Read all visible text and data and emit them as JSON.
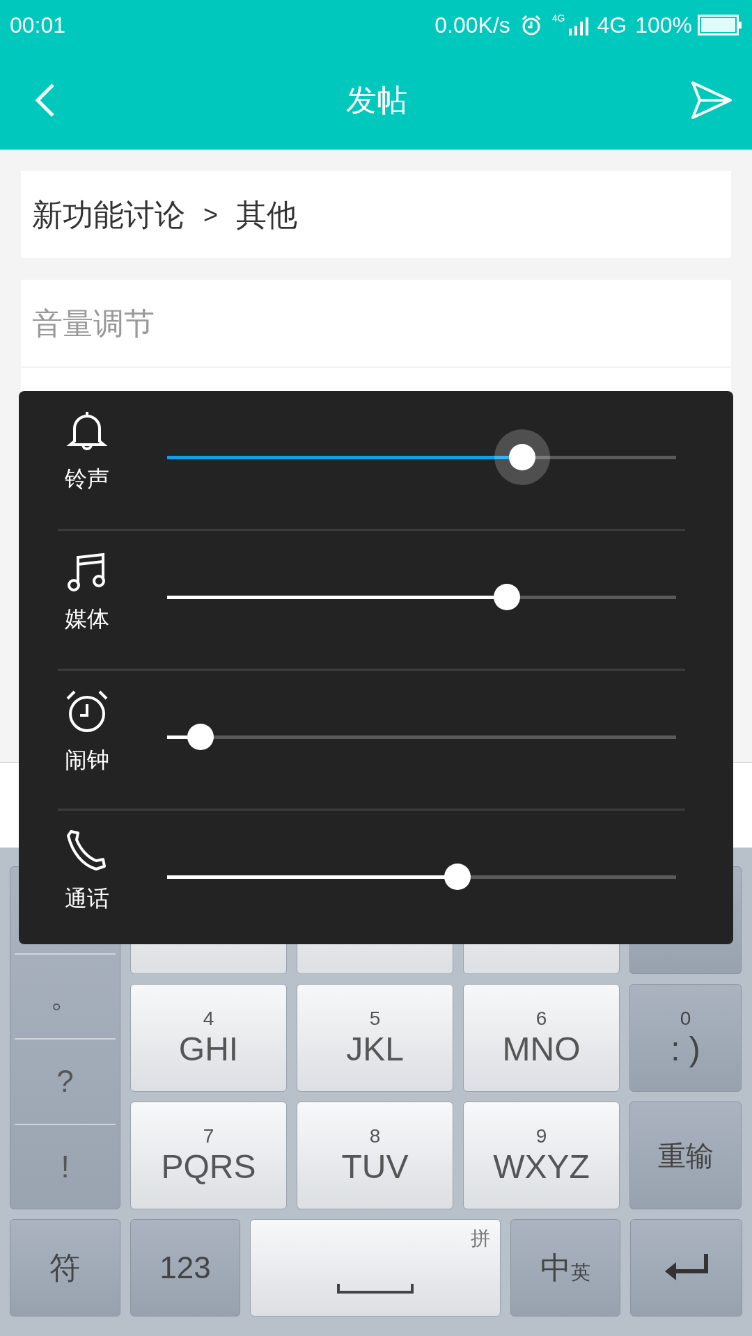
{
  "status_bar": {
    "time": "00:01",
    "speed": "0.00K/s",
    "net_small": "4G",
    "network": "4G",
    "battery": "100%"
  },
  "header": {
    "title": "发帖"
  },
  "category": {
    "section": "新功能讨论",
    "separator": ">",
    "sub": "其他"
  },
  "title_field": {
    "value": "音量调节"
  },
  "volume_panel": {
    "sliders": [
      {
        "kind": "bell",
        "label": "铃声",
        "level": 0.697,
        "selected": true
      },
      {
        "kind": "music",
        "label": "媒体",
        "level": 0.667,
        "selected": false
      },
      {
        "kind": "alarm",
        "label": "闹钟",
        "level": 0.066,
        "selected": false
      },
      {
        "kind": "phone",
        "label": "通话",
        "level": 0.571,
        "selected": false
      }
    ]
  },
  "keyboard": {
    "symbols": [
      "。",
      "?",
      "!"
    ],
    "keys": [
      {
        "kind": "covered_light"
      },
      {
        "kind": "covered_light"
      },
      {
        "kind": "covered_light"
      },
      {
        "kind": "covered_dark"
      },
      {
        "kind": "digit",
        "number": "4",
        "letters": "GHI"
      },
      {
        "kind": "digit",
        "number": "5",
        "letters": "JKL"
      },
      {
        "kind": "digit",
        "number": "6",
        "letters": "MNO"
      },
      {
        "kind": "func_digit",
        "number": "0",
        "letters": ": )"
      },
      {
        "kind": "digit",
        "number": "7",
        "letters": "PQRS"
      },
      {
        "kind": "digit",
        "number": "8",
        "letters": "TUV"
      },
      {
        "kind": "digit",
        "number": "9",
        "letters": "WXYZ"
      },
      {
        "kind": "func",
        "label": "重输"
      }
    ],
    "bottom": [
      {
        "kind": "func",
        "label": "符"
      },
      {
        "kind": "func",
        "label": "123"
      },
      {
        "kind": "space",
        "corner": "拼"
      },
      {
        "kind": "lang",
        "label": "中",
        "small": "英"
      },
      {
        "kind": "enter"
      }
    ]
  }
}
